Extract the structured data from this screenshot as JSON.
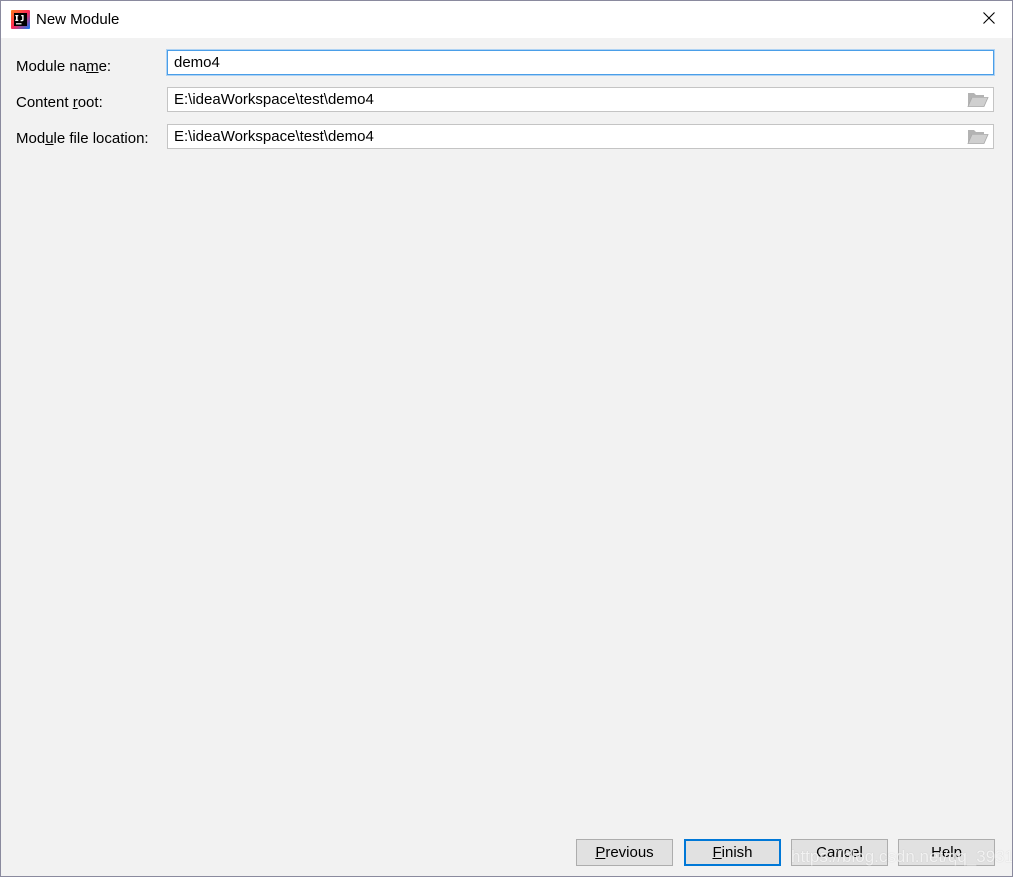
{
  "window": {
    "title": "New Module",
    "app_icon": "intellij-idea-icon",
    "close_icon": "close-icon"
  },
  "form": {
    "module_name": {
      "label_before": "Module na",
      "label_mnemonic": "m",
      "label_after": "e:",
      "value": "demo4"
    },
    "content_root": {
      "label_before": "Content ",
      "label_mnemonic": "r",
      "label_after": "oot:",
      "value": "E:\\ideaWorkspace\\test\\demo4",
      "browse_icon": "folder-open-icon"
    },
    "module_file_location": {
      "label_before": "Mod",
      "label_mnemonic": "u",
      "label_after": "le file location:",
      "value": "E:\\ideaWorkspace\\test\\demo4",
      "browse_icon": "folder-open-icon"
    }
  },
  "buttons": {
    "previous": {
      "mnemonic": "P",
      "rest": "revious"
    },
    "finish": {
      "mnemonic": "F",
      "rest": "inish"
    },
    "cancel": {
      "label": "Cancel"
    },
    "help": {
      "label": "Help"
    }
  },
  "watermark": "https://blog.csdn.net/qq_39319",
  "colors": {
    "dialog_background": "#f2f2f2",
    "titlebar_background": "#ffffff",
    "focus_border": "#4a9ee8",
    "default_button_border": "#0078d7",
    "button_background": "#e1e1e1"
  }
}
